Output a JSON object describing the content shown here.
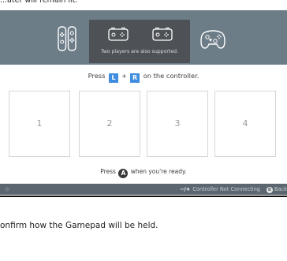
{
  "page": {
    "top_caption": "...ater will remain lit.",
    "bottom_caption": "onfirm how the Gamepad will be held."
  },
  "header": {
    "icons": [
      "joycon-pair-vertical-icon",
      "joycon-sideways-icon",
      "joycon-sideways-icon",
      "pro-controller-icon"
    ],
    "tooltip_text": "Two players are also supported."
  },
  "panel": {
    "instruction_prefix": "Press",
    "button_l": "L",
    "plus": "+",
    "button_r": "R",
    "instruction_suffix": "on the controller.",
    "slots": [
      "1",
      "2",
      "3",
      "4"
    ],
    "ready_prefix": "Press",
    "button_a": "A",
    "ready_suffix": "when you're ready."
  },
  "footer": {
    "keys": "−/+",
    "not_connecting_label": "Controller Not Connecting",
    "back_button": "B",
    "back_label": "Back"
  },
  "colors": {
    "header_bg": "#6d7d88",
    "tooltip_bg": "#4e5257",
    "accent_button": "#3f8dde",
    "footer_bg": "#5b6670"
  }
}
